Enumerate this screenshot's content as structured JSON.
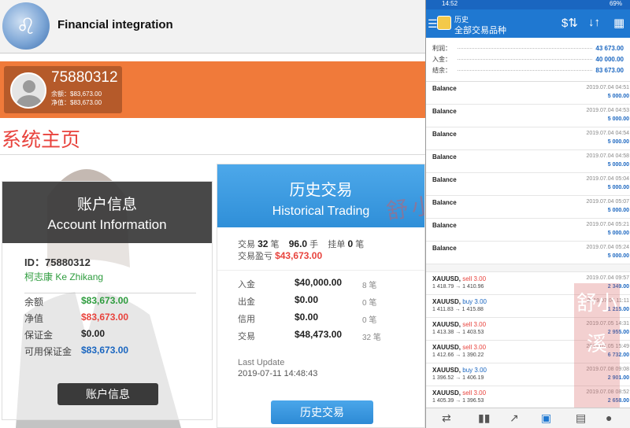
{
  "web": {
    "brand": "Financial integration",
    "user": {
      "account_id": "75880312",
      "balance_line": "余额：$83,673.00",
      "equity_line": "净值：$83,673.00"
    },
    "page_title": "系统主页",
    "account_card": {
      "title_zh": "账户信息",
      "title_en": "Account Information",
      "id_line": "ID：75880312",
      "name_line": "柯志康 Ke Zhikang",
      "rows": [
        {
          "label": "余额",
          "value": "$83,673.00",
          "color": "#2e9c3e"
        },
        {
          "label": "净值",
          "value": "$83,673.00",
          "color": "#e8433d"
        },
        {
          "label": "保证金",
          "value": "$0.00",
          "color": "#222222"
        },
        {
          "label": "可用保证金",
          "value": "$83,673.00",
          "color": "#1a66c0"
        }
      ],
      "button": "账户信息"
    },
    "history_card": {
      "title_zh": "历史交易",
      "title_en": "Historical Trading",
      "trades_label": "交易",
      "trades_count": "32",
      "trades_unit": "笔",
      "lots": "96.0",
      "lots_unit": "手",
      "pending_label": "挂单",
      "pending_count": "0",
      "pending_unit": "笔",
      "pl_label": "交易盈亏",
      "pl_value": "$43,673.00",
      "rows": [
        {
          "label": "入金",
          "value": "$40,000.00",
          "count": "8 笔"
        },
        {
          "label": "出金",
          "value": "$0.00",
          "count": "0 笔"
        },
        {
          "label": "信用",
          "value": "$0.00",
          "count": "0 笔"
        },
        {
          "label": "交易",
          "value": "$48,473.00",
          "count": "32 笔"
        }
      ],
      "last_update_label": "Last Update",
      "last_update_time": "2019-07-11 14:48:43",
      "button": "历史交易"
    },
    "watermark": "舒小溪"
  },
  "phone": {
    "status_time": "14:52",
    "status_right": "69%",
    "app_title": "历史",
    "app_subtitle": "全部交易品种",
    "summary": [
      {
        "label": "利润：",
        "value": "43 673.00"
      },
      {
        "label": "入金：",
        "value": "40 000.00"
      },
      {
        "label": "结余：",
        "value": "83 673.00"
      }
    ],
    "balances": [
      {
        "name": "Balance",
        "date": "2019.07.04 04:51",
        "amount": "5 000.00"
      },
      {
        "name": "Balance",
        "date": "2019.07.04 04:53",
        "amount": "5 000.00"
      },
      {
        "name": "Balance",
        "date": "2019.07.04 04:54",
        "amount": "5 000.00"
      },
      {
        "name": "Balance",
        "date": "2019.07.04 04:58",
        "amount": "5 000.00"
      },
      {
        "name": "Balance",
        "date": "2019.07.04 05:04",
        "amount": "5 000.00"
      },
      {
        "name": "Balance",
        "date": "2019.07.04 05:07",
        "amount": "5 000.00"
      },
      {
        "name": "Balance",
        "date": "2019.07.04 05:21",
        "amount": "5 000.00"
      },
      {
        "name": "Balance",
        "date": "2019.07.04 05:24",
        "amount": "5 000.00"
      }
    ],
    "trades": [
      {
        "symbol": "XAUUSD,",
        "side": "sell",
        "lots": "3.00",
        "prices": "1 418.79 → 1 410.96",
        "date": "2019.07.04 09:57",
        "amount": "2 349.00"
      },
      {
        "symbol": "XAUUSD,",
        "side": "buy",
        "lots": "3.00",
        "prices": "1 411.83 → 1 415.88",
        "date": "2019.07.04 11:11",
        "amount": "1 215.00"
      },
      {
        "symbol": "XAUUSD,",
        "side": "sell",
        "lots": "3.00",
        "prices": "1 413.38 → 1 403.53",
        "date": "2019.07.05 14:31",
        "amount": "2 955.00"
      },
      {
        "symbol": "XAUUSD,",
        "side": "sell",
        "lots": "3.00",
        "prices": "1 412.66 → 1 390.22",
        "date": "2019.07.05 15:49",
        "amount": "6 732.00"
      },
      {
        "symbol": "XAUUSD,",
        "side": "buy",
        "lots": "3.00",
        "prices": "1 396.52 → 1 406.19",
        "date": "2019.07.08 09:08",
        "amount": "2 901.00"
      },
      {
        "symbol": "XAUUSD,",
        "side": "sell",
        "lots": "3.00",
        "prices": "1 405.39 → 1 396.53",
        "date": "2019.07.08 08:52",
        "amount": "2 658.00"
      }
    ],
    "watermark": "舒小溪"
  }
}
